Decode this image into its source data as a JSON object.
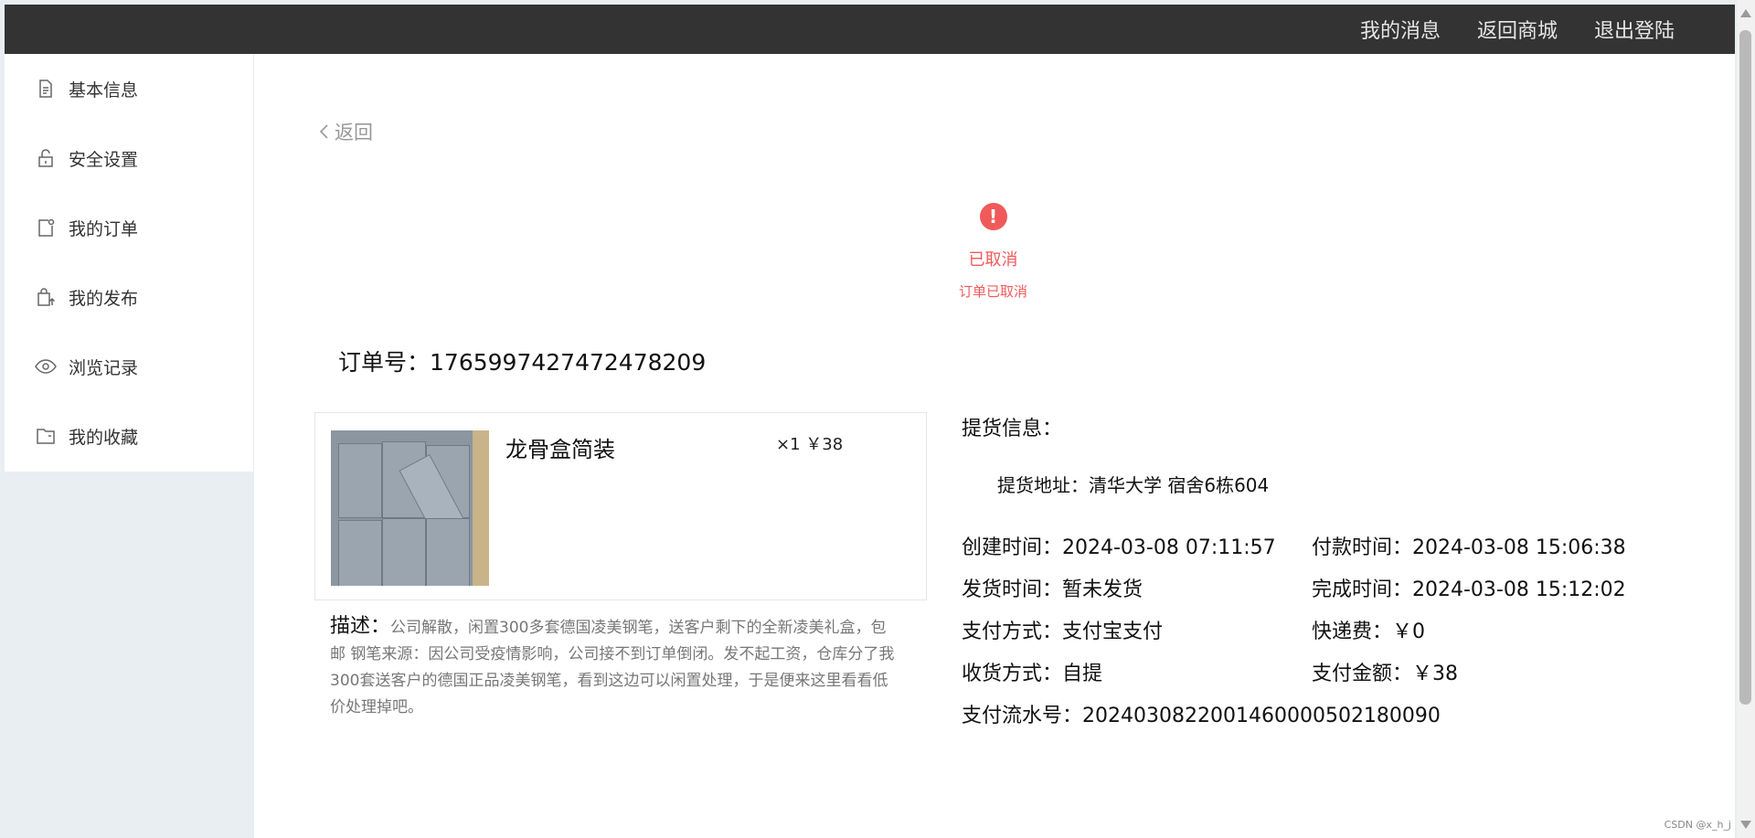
{
  "topnav": {
    "messages": "我的消息",
    "back_to_shop": "返回商城",
    "logout": "退出登陆"
  },
  "sidebar": {
    "items": [
      {
        "label": "基本信息",
        "icon": "document-icon"
      },
      {
        "label": "安全设置",
        "icon": "lock-icon"
      },
      {
        "label": "我的订单",
        "icon": "order-icon"
      },
      {
        "label": "我的发布",
        "icon": "upload-bag-icon"
      },
      {
        "label": "浏览记录",
        "icon": "eye-icon"
      },
      {
        "label": "我的收藏",
        "icon": "folder-icon"
      }
    ]
  },
  "main": {
    "back_label": "返回",
    "status": {
      "icon_symbol": "!",
      "title": "已取消",
      "subtitle": "订单已取消",
      "color": "#f05a5a"
    },
    "order_no_label": "订单号：",
    "order_no": "1765997427472478209",
    "product": {
      "name": "龙骨盒简装",
      "qty_price": "×1 ￥38"
    },
    "description": {
      "label": "描述：",
      "text": "公司解散，闲置300多套德国凌美钢笔，送客户剩下的全新凌美礼盒，包邮 钢笔来源：因公司受疫情影响，公司接不到订单倒闭。发不起工资，仓库分了我300套送客户的德国正品凌美钢笔，看到这边可以闲置处理，于是便来这里看看低价处理掉吧。"
    },
    "info": {
      "title": "提货信息：",
      "pickup_address": "提货地址：清华大学 宿舍6栋604",
      "created": "创建时间：2024-03-08 07:11:57",
      "paid": "付款时间：2024-03-08 15:06:38",
      "shipped": "发货时间：暂未发货",
      "completed": "完成时间：2024-03-08 15:12:02",
      "pay_method": "支付方式：支付宝支付",
      "shipping_fee": "快递费：￥0",
      "receive_method": "收货方式：自提",
      "pay_amount": "支付金额：￥38",
      "pay_serial": "支付流水号：2024030822001460000502180090"
    }
  },
  "watermark": "CSDN @x_h_j"
}
